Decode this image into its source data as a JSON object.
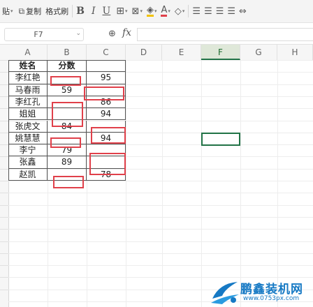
{
  "toolbar": {
    "paste_label": "贴",
    "copy_label": "复制",
    "format_painter_label": "格式刷",
    "bold": "B",
    "italic": "I",
    "underline": "U"
  },
  "formula_bar": {
    "name_box": "F7",
    "fx_label": "fx",
    "formula": ""
  },
  "columns": [
    "A",
    "B",
    "C",
    "D",
    "E",
    "F",
    "G",
    "H"
  ],
  "selected_column": "F",
  "table": {
    "headers": [
      "姓名",
      "分数"
    ],
    "rows": [
      {
        "name": "李红艳",
        "b": "",
        "c": "95"
      },
      {
        "name": "马春雨",
        "b": "59",
        "c": ""
      },
      {
        "name": "李红孔",
        "b": "",
        "c": "86"
      },
      {
        "name": "姐姐",
        "b": "",
        "c": "94"
      },
      {
        "name": "张虎文",
        "b": "84",
        "c": ""
      },
      {
        "name": "姚慧慧",
        "b": "",
        "c": "94"
      },
      {
        "name": "李宁",
        "b": "79",
        "c": ""
      },
      {
        "name": "张鑫",
        "b": "89",
        "c": ""
      },
      {
        "name": "赵凯",
        "b": "",
        "c": "78"
      }
    ]
  },
  "watermark": {
    "text": "鹏鑫装机网",
    "url": "www.0753px.com"
  }
}
